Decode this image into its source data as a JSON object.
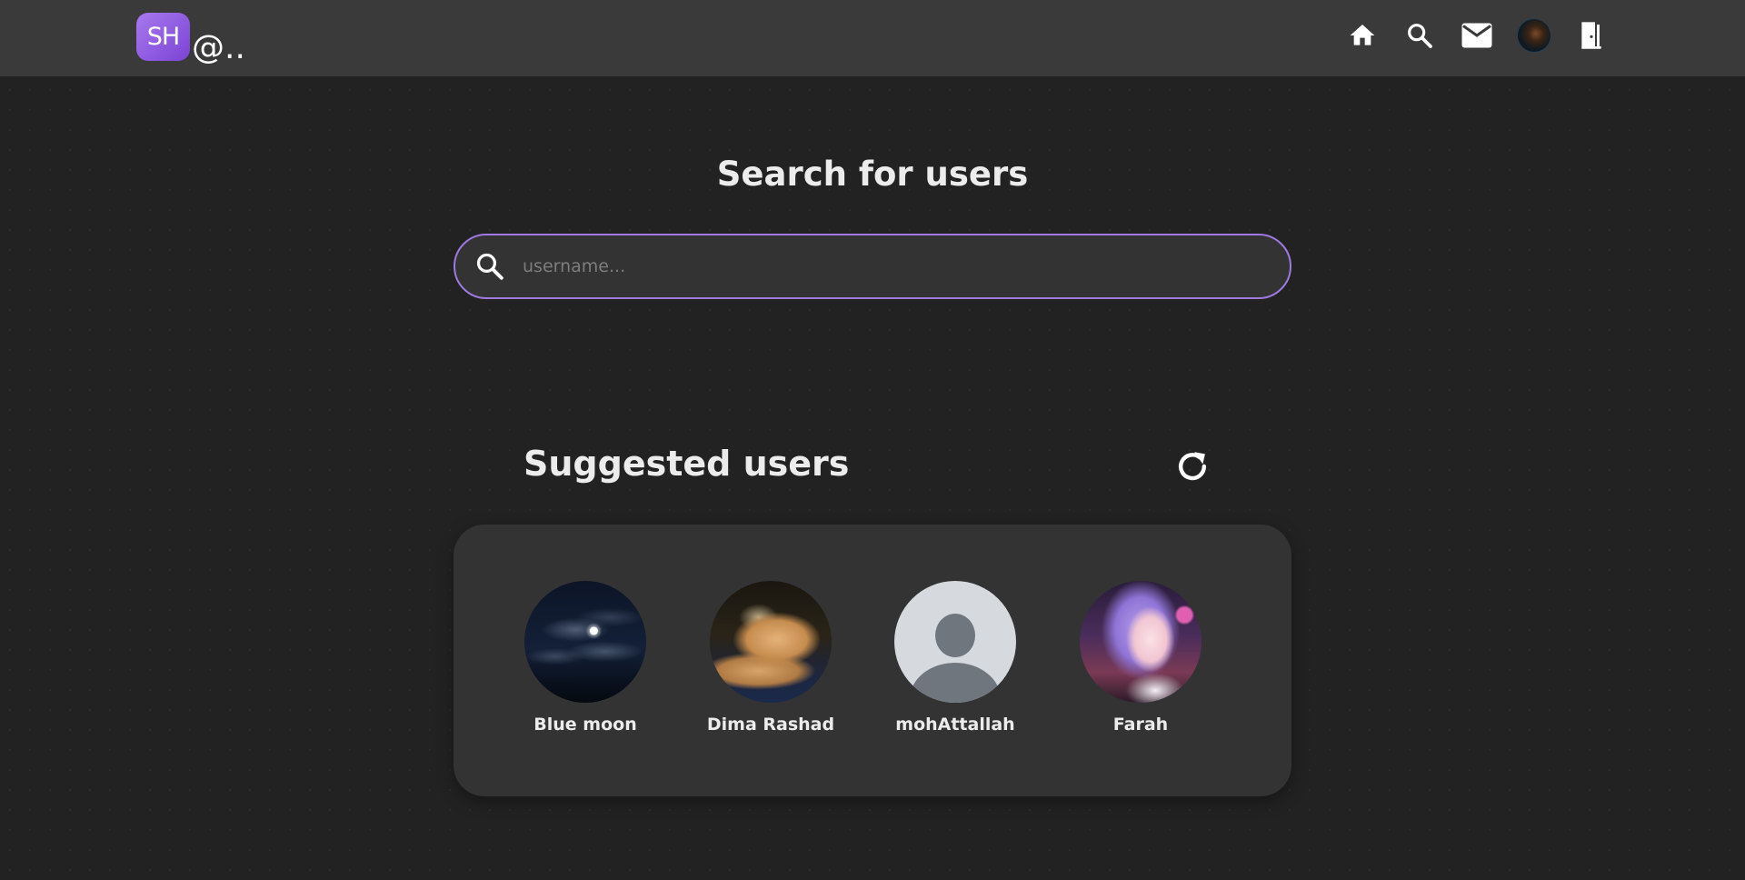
{
  "header": {
    "logo_badge": "SH",
    "logo_suffix": "@..",
    "nav": [
      {
        "icon": "home-icon"
      },
      {
        "icon": "search-icon"
      },
      {
        "icon": "mail-icon"
      },
      {
        "icon": "profile-avatar"
      },
      {
        "icon": "logout-door-icon"
      }
    ]
  },
  "search": {
    "title": "Search for users",
    "placeholder": "username...",
    "value": "",
    "icon": "search-icon"
  },
  "suggested": {
    "title": "Suggested users",
    "refresh_icon": "refresh-icon",
    "users": [
      {
        "name": "Blue moon"
      },
      {
        "name": "Dima Rashad"
      },
      {
        "name": "mohAttallah"
      },
      {
        "name": "Farah"
      }
    ]
  },
  "colors": {
    "background": "#222222",
    "header_bg": "#3a3a3a",
    "card_bg": "#333333",
    "accent": "#9d7ae0",
    "logo_gradient_start": "#a779ee",
    "logo_gradient_end": "#7b43d6",
    "text": "#ececec"
  }
}
